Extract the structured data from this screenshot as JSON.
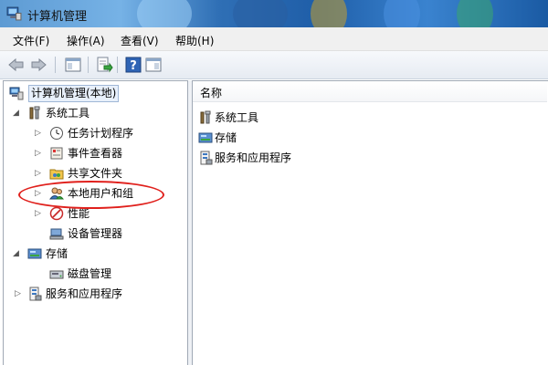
{
  "window": {
    "title": "计算机管理"
  },
  "menu": [
    {
      "label": "文件(F)"
    },
    {
      "label": "操作(A)"
    },
    {
      "label": "查看(V)"
    },
    {
      "label": "帮助(H)"
    }
  ],
  "toolbar": {
    "icons": [
      "back-arrow-icon",
      "forward-arrow-icon",
      "show-hide-tree-icon",
      "export-list-icon",
      "help-icon",
      "properties-pane-icon"
    ]
  },
  "tree": {
    "root": {
      "label": "计算机管理(本地)"
    },
    "items": [
      {
        "label": "系统工具",
        "expanded": true
      },
      {
        "label": "任务计划程序"
      },
      {
        "label": "事件查看器"
      },
      {
        "label": "共享文件夹"
      },
      {
        "label": "本地用户和组"
      },
      {
        "label": "性能"
      },
      {
        "label": "设备管理器"
      },
      {
        "label": "存储",
        "expanded": true
      },
      {
        "label": "磁盘管理"
      },
      {
        "label": "服务和应用程序"
      }
    ]
  },
  "list": {
    "column": "名称",
    "rows": [
      {
        "label": "系统工具"
      },
      {
        "label": "存储"
      },
      {
        "label": "服务和应用程序"
      }
    ]
  },
  "colors": {
    "highlight": "#e0201c",
    "titlebar": "#2f6fb5"
  }
}
